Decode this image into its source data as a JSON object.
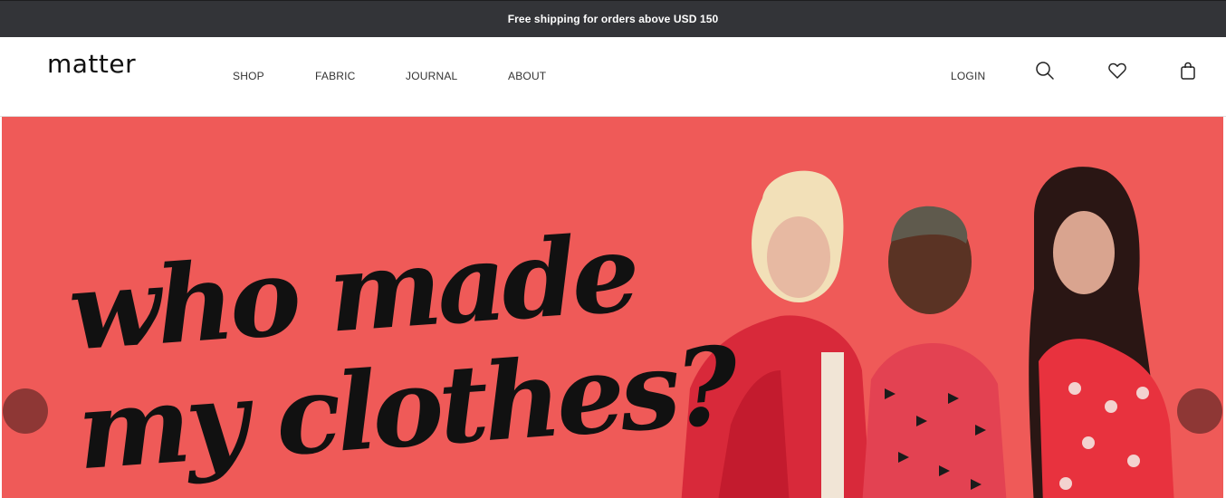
{
  "announcement": {
    "text": "Free shipping for orders above USD 150"
  },
  "header": {
    "logo": "matter",
    "nav": [
      {
        "label": "SHOP"
      },
      {
        "label": "FABRIC"
      },
      {
        "label": "JOURNAL"
      },
      {
        "label": "ABOUT"
      }
    ],
    "login_label": "LOGIN",
    "icons": [
      "search-icon",
      "heart-icon",
      "shopping-bag-icon"
    ]
  },
  "hero": {
    "headline_line1": "who made",
    "headline_line2": "my clothes?",
    "background_color": "#ef5a58",
    "slider_arrow_color": "#8e3735"
  }
}
